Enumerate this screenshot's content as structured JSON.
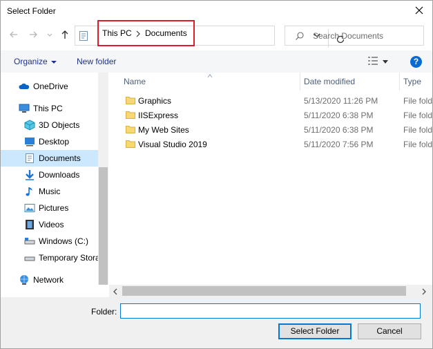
{
  "window": {
    "title": "Select Folder"
  },
  "address": {
    "crumbs": [
      "This PC",
      "Documents"
    ]
  },
  "search": {
    "placeholder": "Search Documents"
  },
  "toolbar": {
    "organize": "Organize",
    "new_folder": "New folder",
    "help": "?"
  },
  "nav": {
    "items": [
      {
        "label": "OneDrive",
        "icon": "onedrive-icon"
      },
      {
        "label": "This PC",
        "icon": "this-pc-icon"
      },
      {
        "label": "3D Objects",
        "icon": "3d-objects-icon"
      },
      {
        "label": "Desktop",
        "icon": "desktop-icon"
      },
      {
        "label": "Documents",
        "icon": "documents-icon",
        "selected": true
      },
      {
        "label": "Downloads",
        "icon": "downloads-icon"
      },
      {
        "label": "Music",
        "icon": "music-icon"
      },
      {
        "label": "Pictures",
        "icon": "pictures-icon"
      },
      {
        "label": "Videos",
        "icon": "videos-icon"
      },
      {
        "label": "Windows (C:)",
        "icon": "drive-icon"
      },
      {
        "label": "Temporary Stora",
        "icon": "drive-icon"
      },
      {
        "label": "Network",
        "icon": "network-icon"
      }
    ]
  },
  "files": {
    "columns": {
      "name": "Name",
      "date": "Date modified",
      "type": "Type"
    },
    "rows": [
      {
        "name": "Graphics",
        "date": "5/13/2020 11:26 PM",
        "type": "File fold"
      },
      {
        "name": "IISExpress",
        "date": "5/11/2020 6:38 PM",
        "type": "File fold"
      },
      {
        "name": "My Web Sites",
        "date": "5/11/2020 6:38 PM",
        "type": "File fold"
      },
      {
        "name": "Visual Studio 2019",
        "date": "5/11/2020 7:56 PM",
        "type": "File fold"
      }
    ]
  },
  "bottom": {
    "folder_label": "Folder:",
    "folder_value": "",
    "select_button": "Select Folder",
    "cancel_button": "Cancel"
  },
  "colors": {
    "accent": "#0078d7",
    "highlight_box": "#e0192b",
    "selected_bg": "#cce8ff",
    "folder": "#f8d775"
  }
}
